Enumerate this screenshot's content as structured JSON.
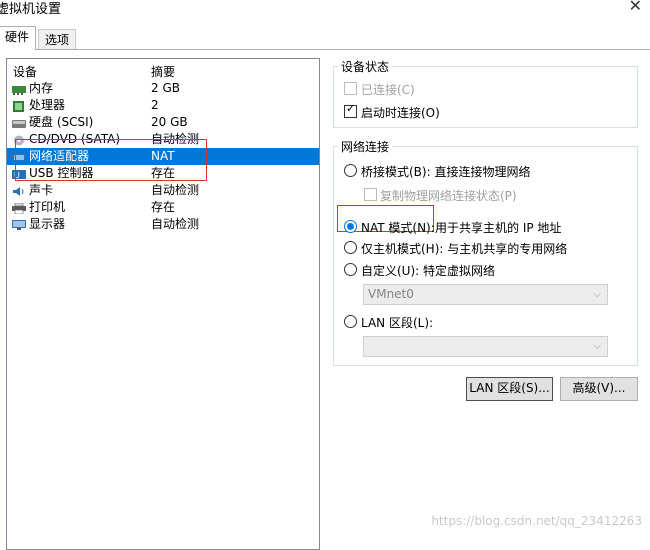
{
  "window": {
    "title": "虚拟机设置"
  },
  "tabs": [
    {
      "label": "硬件",
      "active": true
    },
    {
      "label": "选项",
      "active": false
    }
  ],
  "devices": {
    "columns": [
      "设备",
      "摘要"
    ],
    "rows": [
      {
        "name": "内存",
        "summary": "2 GB",
        "icon": "memory-icon"
      },
      {
        "name": "处理器",
        "summary": "2",
        "icon": "processor-icon"
      },
      {
        "name": "硬盘 (SCSI)",
        "summary": "20 GB",
        "icon": "harddisk-icon"
      },
      {
        "name": "CD/DVD (SATA)",
        "summary": "自动检测",
        "icon": "cd-dvd-icon"
      },
      {
        "name": "网络适配器",
        "summary": "NAT",
        "icon": "network-adapter-icon",
        "selected": true
      },
      {
        "name": "USB 控制器",
        "summary": "存在",
        "icon": "usb-icon"
      },
      {
        "name": "声卡",
        "summary": "自动检测",
        "icon": "sound-card-icon"
      },
      {
        "name": "打印机",
        "summary": "存在",
        "icon": "printer-icon"
      },
      {
        "name": "显示器",
        "summary": "自动检测",
        "icon": "display-icon"
      }
    ]
  },
  "device_status": {
    "legend": "设备状态",
    "connected": "已连接(C)",
    "connect_on_start": "启动时连接(O)"
  },
  "network": {
    "legend": "网络连接",
    "bridged": "桥接模式(B): 直接连接物理网络",
    "replicate": "复制物理网络连接状态(P)",
    "nat": "NAT 模式(N):",
    "nat_desc": "用于共享主机的 IP 地址",
    "host_only": "仅主机模式(H): 与主机共享的专用网络",
    "custom": "自定义(U): 特定虚拟网络",
    "custom_value": "VMnet0",
    "lan": "LAN 区段(L):",
    "lan_value": ""
  },
  "buttons": {
    "lan_segments": "LAN 区段(S)...",
    "advanced": "高级(V)..."
  },
  "watermark": "https://blog.csdn.net/qq_23412263",
  "colors": {
    "selection": "#0078d7",
    "annotation": "#e0302a"
  }
}
